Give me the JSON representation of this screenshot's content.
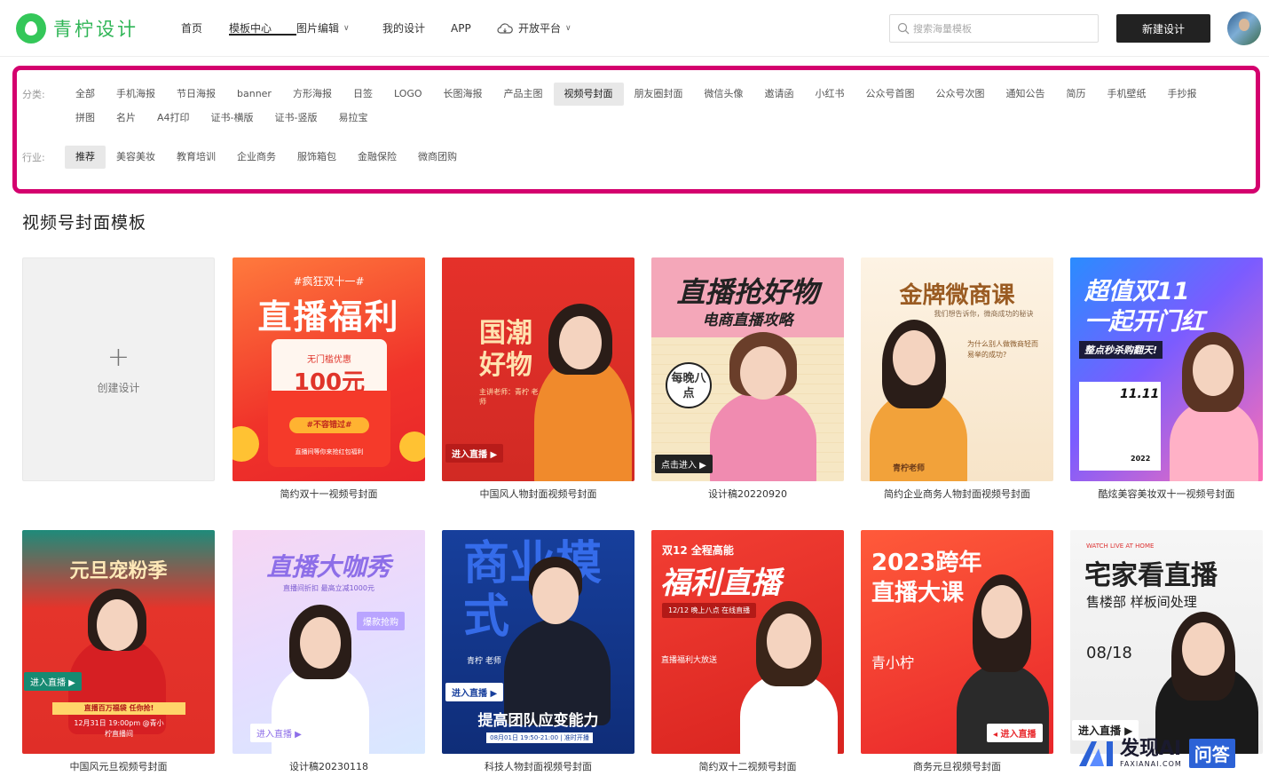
{
  "brand": {
    "name": "青柠设计"
  },
  "nav": [
    {
      "label": "首页",
      "dropdown": false
    },
    {
      "label": "模板中心",
      "dropdown": false,
      "active": true
    },
    {
      "label": "图片编辑",
      "dropdown": true
    },
    {
      "label": "我的设计",
      "dropdown": false
    },
    {
      "label": "APP",
      "dropdown": false
    },
    {
      "label": "开放平台",
      "dropdown": true
    }
  ],
  "search": {
    "placeholder": "搜索海量模板"
  },
  "new_button": "新建设计",
  "filters": {
    "category_label": "分类:",
    "categories_row1": [
      "全部",
      "手机海报",
      "节日海报",
      "banner",
      "方形海报",
      "日签",
      "LOGO",
      "长图海报",
      "产品主图",
      "视频号封面",
      "朋友圈封面",
      "微信头像",
      "邀请函",
      "小红书",
      "公众号首图",
      "公众号次图",
      "通知公告",
      "简历",
      "手机壁纸",
      "手抄报"
    ],
    "categories_row2": [
      "拼图",
      "名片",
      "A4打印",
      "证书-横版",
      "证书-竖版",
      "易拉宝"
    ],
    "active_category": "视频号封面",
    "industry_label": "行业:",
    "industries": [
      "推荐",
      "美容美妆",
      "教育培训",
      "企业商务",
      "服饰箱包",
      "金融保险",
      "微商团购"
    ],
    "active_industry": "推荐"
  },
  "section_title": "视频号封面模板",
  "create_card": {
    "label": "创建设计"
  },
  "templates": [
    {
      "caption": "简约双十一视频号封面",
      "headline": "直播福利",
      "topline": "#疯狂双十一#",
      "detail": "无门槛优惠",
      "price": "100元",
      "badge": "#不容错过#",
      "footer": "直播间等你来抢红包福利"
    },
    {
      "caption": "中国风人物封面视频号封面",
      "headline": "国潮好物",
      "detail": "主讲老师：青柠 老师",
      "badge": "进入直播 ▶"
    },
    {
      "caption": "设计稿20220920",
      "headline": "直播抢好物",
      "topline": "电商直播攻略",
      "detail": "每晚八点",
      "badge": "点击进入 ▶"
    },
    {
      "caption": "简约企业商务人物封面视频号封面",
      "headline": "金牌微商课",
      "topline": "我们想告诉你，微商成功的秘诀",
      "detail": "为什么别人做微商轻而易举的成功?",
      "badge": "青柠老师"
    },
    {
      "caption": "酷炫美容美妆双十一视频号封面",
      "headline": "超值双11",
      "topline": "一起开门红",
      "detail": "整点秒杀购翻天!",
      "badge": "11.11",
      "footer": "2022"
    },
    {
      "caption": "中国风元旦视频号封面",
      "headline": "元旦宠粉季",
      "detail": "直播百万福袋 任你抢!",
      "badge": "进入直播 ▶",
      "footer": "12月31日 19:00pm @青小柠直播间"
    },
    {
      "caption": "设计稿20230118",
      "headline": "直播大咖秀",
      "topline": "直播间折扣 最高立减1000元",
      "detail": "爆款抢购",
      "badge": "进入直播 ▶"
    },
    {
      "caption": "科技人物封面视频号封面",
      "headline": "商业模式",
      "topline": "青柠 老师",
      "detail": "提高团队应变能力",
      "badge": "进入直播 ▶",
      "footer": "08月01日 19:50-21:00 | 准时开播"
    },
    {
      "caption": "简约双十二视频号封面",
      "headline": "福利直播",
      "topline": "双12 全程高能",
      "detail": "12/12 晚上八点 在线直播",
      "badge": "直播福利大放送"
    },
    {
      "caption": "商务元旦视频号封面",
      "headline": "2023跨年",
      "topline": "直播大课",
      "detail": "青小柠",
      "badge": "◂ 进入直播"
    },
    {
      "caption": "",
      "headline": "宅家看直播",
      "topline": "售楼部 样板间处理",
      "detail": "08/18",
      "badge": "进入直播 ▶",
      "footer": "WATCH LIVE AT HOME"
    }
  ],
  "watermark": {
    "brand": "发现AI",
    "sub": "FAXIANAI.COM",
    "box": "问答"
  }
}
